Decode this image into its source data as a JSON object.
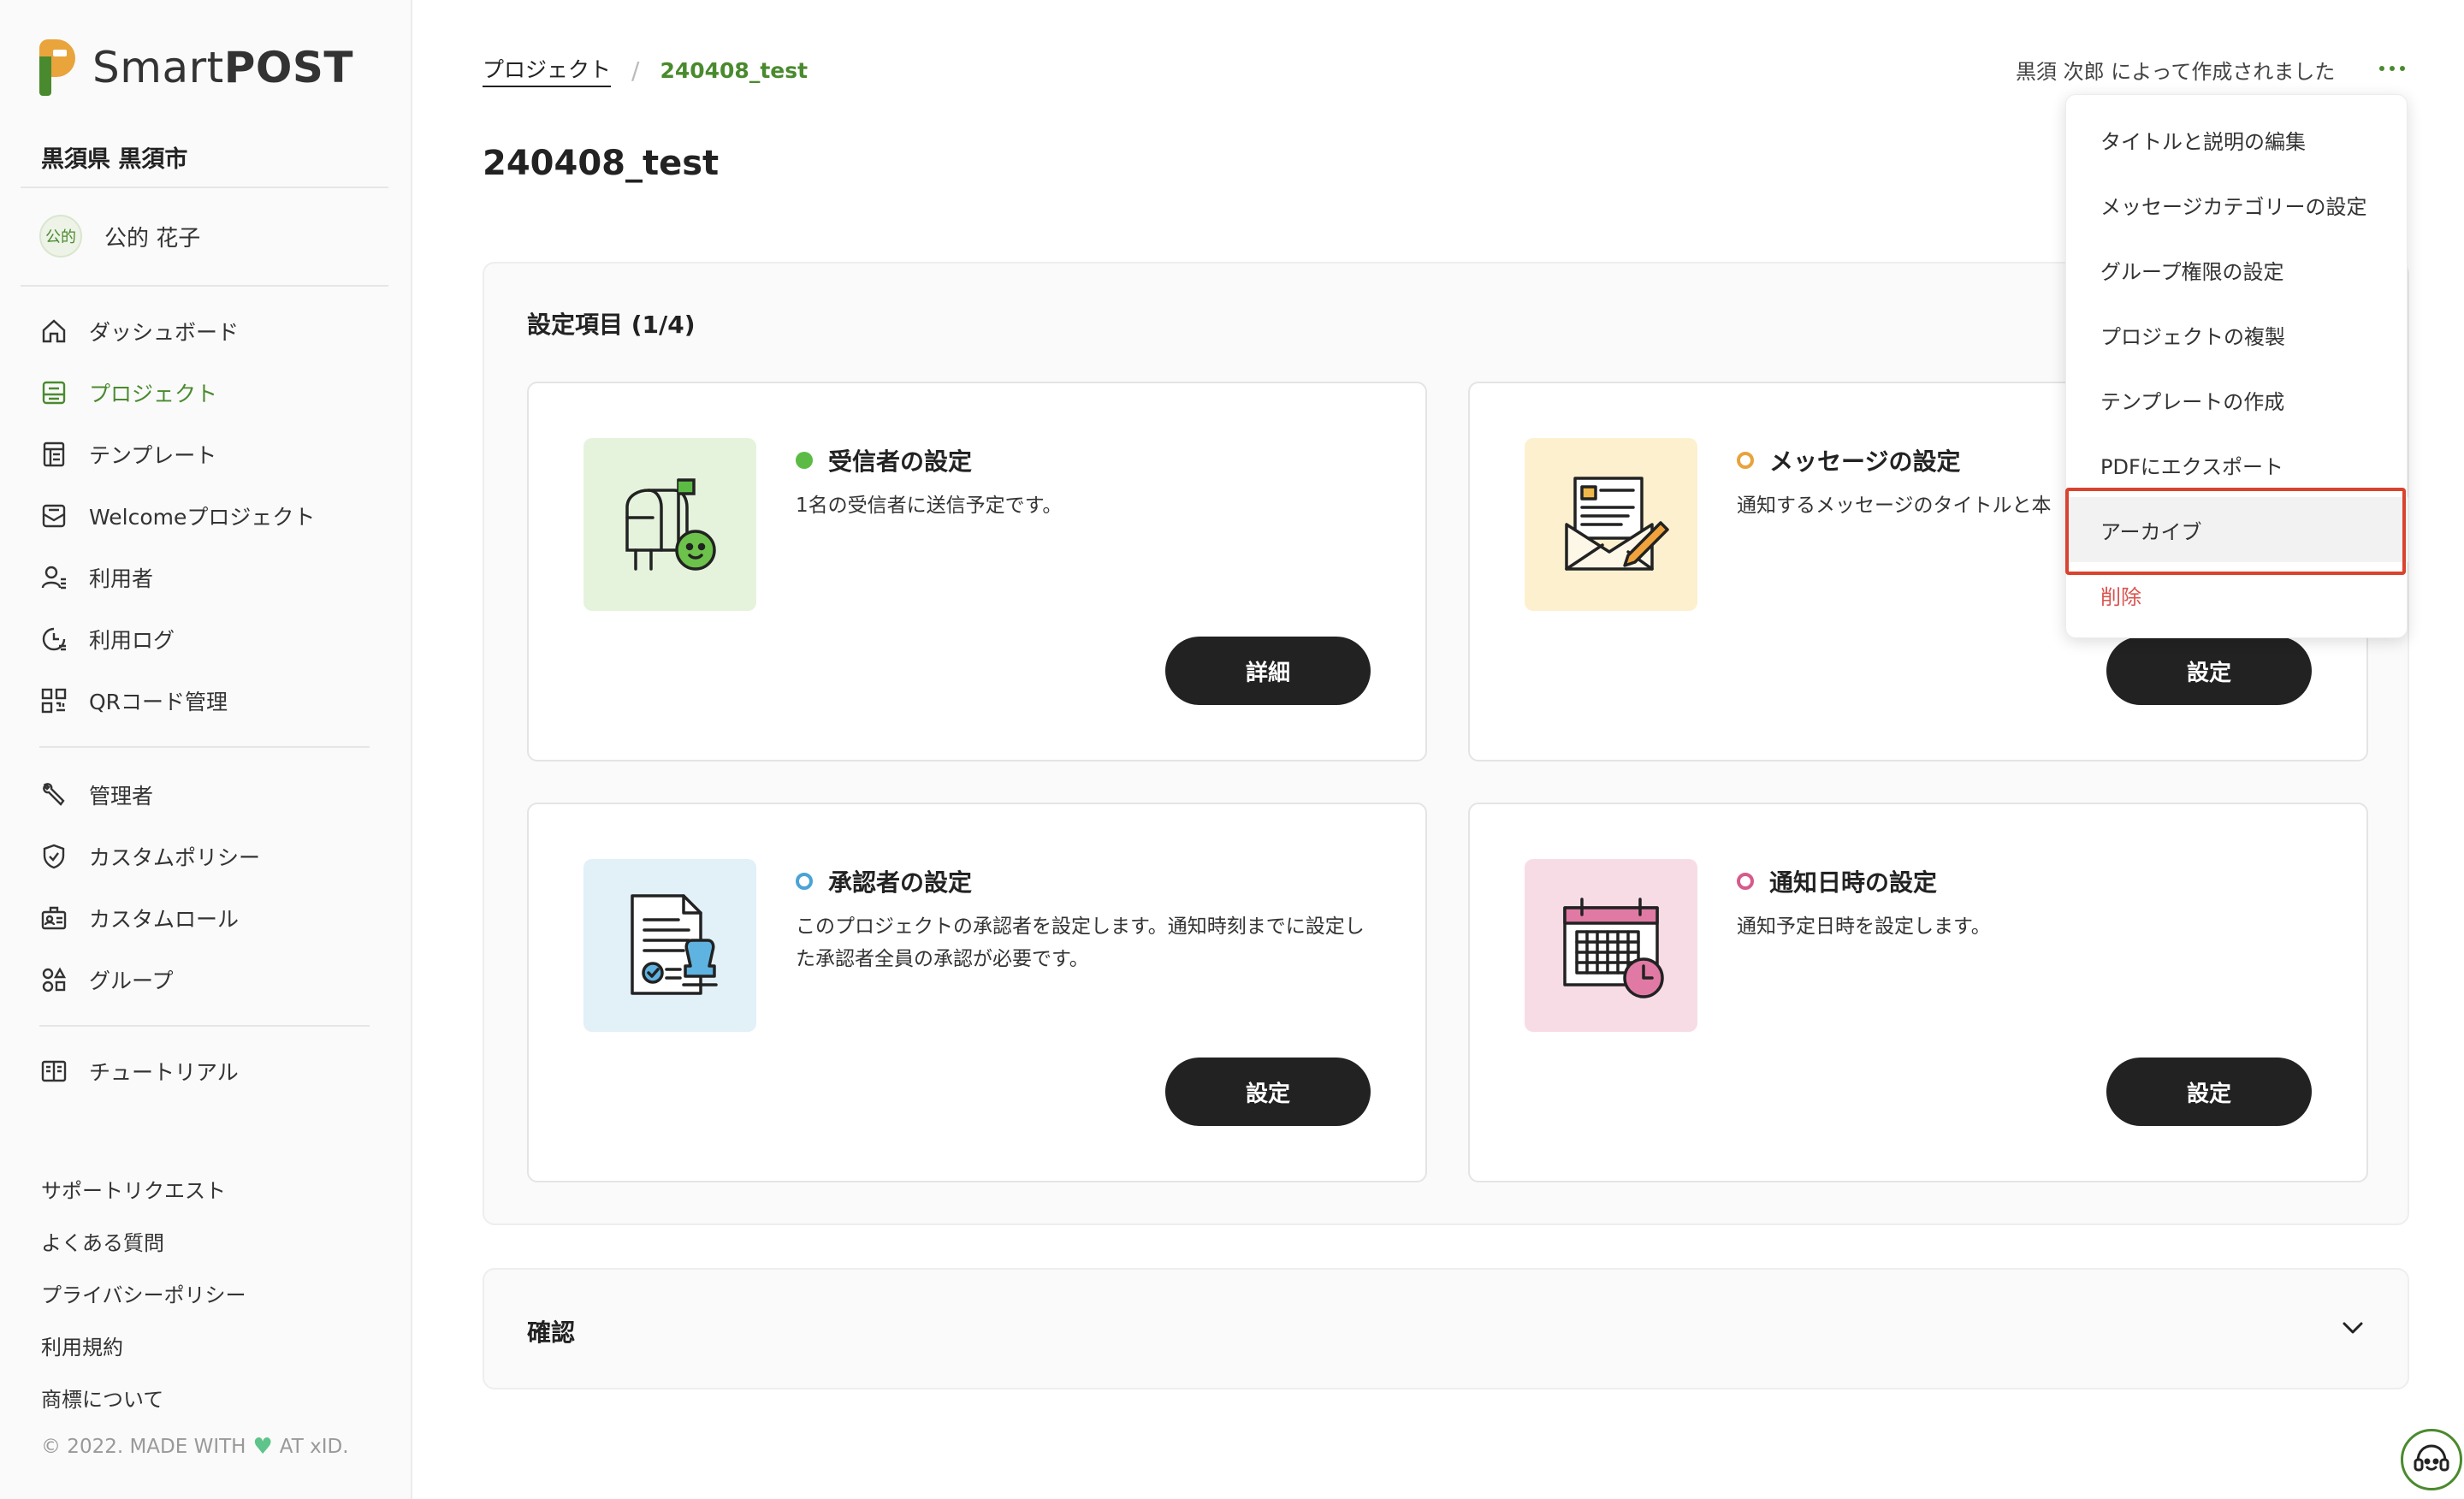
{
  "app": {
    "logo_part1": "Smart",
    "logo_part2": "POST",
    "org_name": "黒須県 黒須市",
    "user": {
      "badge": "公的",
      "name": "公的 花子"
    }
  },
  "sidebar": {
    "nav_primary": [
      {
        "label": "ダッシュボード",
        "icon": "home-icon"
      },
      {
        "label": "プロジェクト",
        "icon": "project-icon",
        "active": true
      },
      {
        "label": "テンプレート",
        "icon": "template-icon"
      },
      {
        "label": "Welcomeプロジェクト",
        "icon": "welcome-mail-icon"
      },
      {
        "label": "利用者",
        "icon": "user-icon"
      },
      {
        "label": "利用ログ",
        "icon": "log-icon"
      },
      {
        "label": "QRコード管理",
        "icon": "qr-icon"
      }
    ],
    "nav_admin": [
      {
        "label": "管理者",
        "icon": "wrench-icon"
      },
      {
        "label": "カスタムポリシー",
        "icon": "shield-icon"
      },
      {
        "label": "カスタムロール",
        "icon": "role-icon"
      },
      {
        "label": "グループ",
        "icon": "group-icon"
      }
    ],
    "nav_help": [
      {
        "label": "チュートリアル",
        "icon": "book-icon"
      }
    ],
    "footer_links": [
      "サポートリクエスト",
      "よくある質問",
      "プライバシーポリシー",
      "利用規約",
      "商標について"
    ],
    "copyright_pre": "© 2022. MADE WITH",
    "copyright_post": "AT xID."
  },
  "header": {
    "breadcrumb_root": "プロジェクト",
    "breadcrumb_sep": "/",
    "breadcrumb_current": "240408_test",
    "created_by": "黒須 次郎 によって作成されました"
  },
  "page": {
    "title": "240408_test",
    "settings_title": "設定項目 (1/4)",
    "cards": [
      {
        "title": "受信者の設定",
        "desc": "1名の受信者に送信予定です。",
        "button": "詳細"
      },
      {
        "title": "メッセージの設定",
        "desc": "通知するメッセージのタイトルと本",
        "button": "設定"
      },
      {
        "title": "承認者の設定",
        "desc": "このプロジェクトの承認者を設定します。通知時刻までに設定した承認者全員の承認が必要です。",
        "button": "設定"
      },
      {
        "title": "通知日時の設定",
        "desc": "通知予定日時を設定します。",
        "button": "設定"
      }
    ],
    "confirm_title": "確認"
  },
  "menu": {
    "items": [
      "タイトルと説明の編集",
      "メッセージカテゴリーの設定",
      "グループ権限の設定",
      "プロジェクトの複製",
      "テンプレートの作成",
      "PDFにエクスポート",
      "アーカイブ",
      "削除"
    ]
  },
  "colors": {
    "brand_green": "#4a8a2e",
    "danger": "#d9534f",
    "highlight": "#d9432f"
  }
}
